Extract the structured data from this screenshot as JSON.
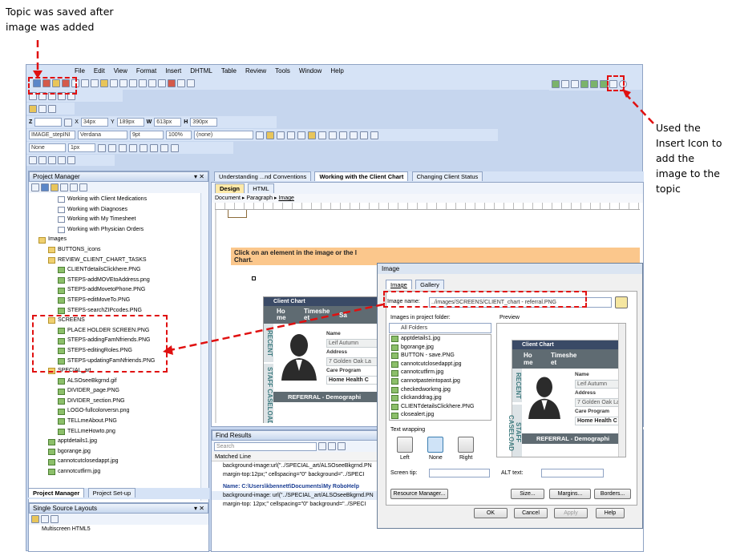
{
  "annotations": {
    "top_left": "Topic was saved after\nimage was added",
    "right": "Used the\nInsert Icon to\nadd the\nimage to the\ntopic",
    "accent": "#e01010"
  },
  "menu": [
    "File",
    "Edit",
    "View",
    "Format",
    "Insert",
    "DHTML",
    "Table",
    "Review",
    "Tools",
    "Window",
    "Help"
  ],
  "toolbar": {
    "z_label": "Z",
    "x_label": "X",
    "x_value": "34px",
    "y_label": "Y",
    "y_value": "189px",
    "w_label": "W",
    "w_value": "613px",
    "h_label": "H",
    "h_value": "390px",
    "element_name": "IMAGE_stepINI",
    "font": "Verdana",
    "size": "9pt",
    "zoom": "100%",
    "style": "(none)",
    "border": "None",
    "border_width": "1px"
  },
  "project_manager": {
    "title": "Project Manager",
    "tree": [
      {
        "label": "Working with Client Medications",
        "kind": "topic",
        "indent": 2
      },
      {
        "label": "Working with Diagnoses",
        "kind": "topic",
        "indent": 2
      },
      {
        "label": "Working with My Timesheet",
        "kind": "topic",
        "indent": 2
      },
      {
        "label": "Working with Physician Orders",
        "kind": "topic",
        "indent": 2
      },
      {
        "label": "Images",
        "kind": "folder",
        "indent": 0
      },
      {
        "label": "BUTTONS_icons",
        "kind": "folder",
        "indent": 1
      },
      {
        "label": "REVIEW_CLIENT_CHART_TASKS",
        "kind": "folder",
        "indent": 1
      },
      {
        "label": "CLIENTdetailsClickhere.PNG",
        "kind": "image",
        "indent": 2
      },
      {
        "label": "STEPS-addMOVEtoAddress.png",
        "kind": "image",
        "indent": 2
      },
      {
        "label": "STEPS-addMovetoPhone.PNG",
        "kind": "image",
        "indent": 2
      },
      {
        "label": "STEPS-editMoveTo.PNG",
        "kind": "image",
        "indent": 2
      },
      {
        "label": "STEPS-searchZIPcodes.PNG",
        "kind": "image",
        "indent": 2
      },
      {
        "label": "SCREENS",
        "kind": "folder",
        "indent": 1
      },
      {
        "label": "PLACE HOLDER SCREEN.PNG",
        "kind": "image",
        "indent": 2
      },
      {
        "label": "STEPS-addingFamNfriends.PNG",
        "kind": "image",
        "indent": 2
      },
      {
        "label": "STEPS-editingRoles.PNG",
        "kind": "image",
        "indent": 2
      },
      {
        "label": "STEPS-updatingFamNfriends.PNG",
        "kind": "image",
        "indent": 2
      },
      {
        "label": "SPECIAL_art",
        "kind": "folder",
        "indent": 1
      },
      {
        "label": "ALSOseeBkgrnd.gif",
        "kind": "image",
        "indent": 2
      },
      {
        "label": "DIVIDER_page.PNG",
        "kind": "image",
        "indent": 2
      },
      {
        "label": "DIVIDER_section.PNG",
        "kind": "image",
        "indent": 2
      },
      {
        "label": "LOGO-fullcolorversn.png",
        "kind": "image",
        "indent": 2
      },
      {
        "label": "TELLmeAbout.PNG",
        "kind": "image",
        "indent": 2
      },
      {
        "label": "TELLmeHowto.png",
        "kind": "image",
        "indent": 2
      },
      {
        "label": "apptdetails1.jpg",
        "kind": "image",
        "indent": 1
      },
      {
        "label": "bgorange.jpg",
        "kind": "image",
        "indent": 1
      },
      {
        "label": "cannotcutclosedappt.jpg",
        "kind": "image",
        "indent": 1
      },
      {
        "label": "cannotcutfirm.jpg",
        "kind": "image",
        "indent": 1
      }
    ],
    "tabs": [
      "Project Manager",
      "Project Set-up"
    ]
  },
  "single_source": {
    "title": "Single Source Layouts",
    "item": "Multiscreen HTML5"
  },
  "editor": {
    "tabs": [
      "Understanding ...nd Conventions",
      "Working with the Client Chart",
      "Changing Client Status"
    ],
    "view_tabs": [
      "Design",
      "HTML"
    ],
    "breadcrumb": [
      "Document",
      "Paragraph",
      "Image"
    ],
    "banner": "Click on an element in the image or the l",
    "banner2": "Chart."
  },
  "client_chart": {
    "title": "Client Chart",
    "nav": [
      "Ho me",
      "Timeshe et",
      "Sa"
    ],
    "side": [
      "RECENT",
      "STAFF CASELOAD"
    ],
    "name_label": "Name",
    "name_value": "Leif  Autumn",
    "address_label": "Address",
    "address_value": "7 Golden Oak La",
    "care_label": "Care Program",
    "care_value": "Home Health C",
    "bar": "REFERRAL - Demographi"
  },
  "find_results": {
    "title": "Find Results",
    "search_placeholder": "Search",
    "column": "Matched Line",
    "lines": [
      "background-image:url(\"../SPECIAL_art/ALSOseeBkgrnd.PN",
      "margin-top:12px;\" cellspacing=\"0\" background=\"../SPECI",
      "Name: C:\\Users\\kbennett\\Documents\\My RoboHelp",
      "background-image: url(\"../SPECIAL_art/ALSOseeBkgrnd.PN",
      "margin-top: 12px;\" cellspacing=\"0\" background=\"../SPECI"
    ]
  },
  "dialog": {
    "title": "Image",
    "tabs": [
      "Image",
      "Gallery"
    ],
    "image_name_label": "Image name:",
    "image_name_value": "../images/SCREENS/CLIENT_chart - referral.PNG",
    "project_folder_label": "Images in project folder:",
    "folder_select": "All Folders",
    "preview_label": "Preview",
    "files": [
      "apptdetails1.jpg",
      "bgorange.jpg",
      "BUTTON - save.PNG",
      "cannotcutclosedappt.jpg",
      "cannotcutfirm.jpg",
      "cannotpasteintopast.jpg",
      "checkedworkmg.jpg",
      "clickanddrag.jpg",
      "CLIENTdetailsClickhere.PNG",
      "closealert.jpg"
    ],
    "wrap_label": "Text wrapping",
    "wrap_options": [
      "Left",
      "None",
      "Right"
    ],
    "screen_tip_label": "Screen tip:",
    "alt_label": "ALT text:",
    "buttons": {
      "resource": "Resource Manager...",
      "size": "Size...",
      "margins": "Margins...",
      "borders": "Borders...",
      "ok": "OK",
      "cancel": "Cancel",
      "apply": "Apply",
      "help": "Help"
    }
  }
}
